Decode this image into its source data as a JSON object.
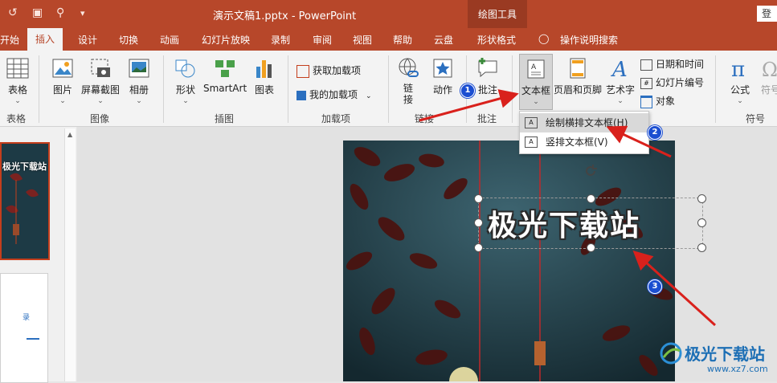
{
  "titlebar": {
    "doc_title": "演示文稿1.pptx  -  PowerPoint",
    "context_label": "绘图工具",
    "login": "登"
  },
  "tabs": [
    "开始",
    "插入",
    "设计",
    "切换",
    "动画",
    "幻灯片放映",
    "录制",
    "审阅",
    "视图",
    "帮助",
    "云盘",
    "形状格式",
    "操作说明搜索"
  ],
  "ribbon": {
    "table": {
      "label": "表格",
      "group": "表格"
    },
    "images": {
      "picture": "图片",
      "screenshot": "屏幕截图",
      "album": "相册",
      "group": "图像"
    },
    "illustrations": {
      "shapes": "形状",
      "smartart": "SmartArt",
      "chart": "图表",
      "group": "插图"
    },
    "addins": {
      "get": "获取加载项",
      "mine": "我的加载项",
      "group": "加载项"
    },
    "links": {
      "link": "链\n接",
      "action": "动作",
      "group": "链接"
    },
    "comments": {
      "comment": "批注",
      "group": "批注"
    },
    "text": {
      "textbox": "文本框",
      "header": "页眉和页脚",
      "wordart": "艺术字",
      "datetime": "日期和时间",
      "slidenum": "幻灯片编号",
      "object": "对象"
    },
    "symbols": {
      "formula": "公式",
      "symbol": "符号",
      "group": "符号"
    }
  },
  "dropdown": {
    "horizontal": "绘制横排文本框(H)",
    "vertical": "竖排文本框(V)"
  },
  "slide": {
    "text": "极光下载站"
  },
  "thumbnails": {
    "thumb1_text": "极光下载站",
    "thumb2_text": "录"
  },
  "badges": [
    "1",
    "2",
    "3"
  ],
  "watermark": {
    "name": "极光下载站",
    "url": "www.xz7.com"
  },
  "colors": {
    "accent": "#b7472a",
    "badge": "#1b4ed1",
    "arrow": "#d9211c"
  }
}
